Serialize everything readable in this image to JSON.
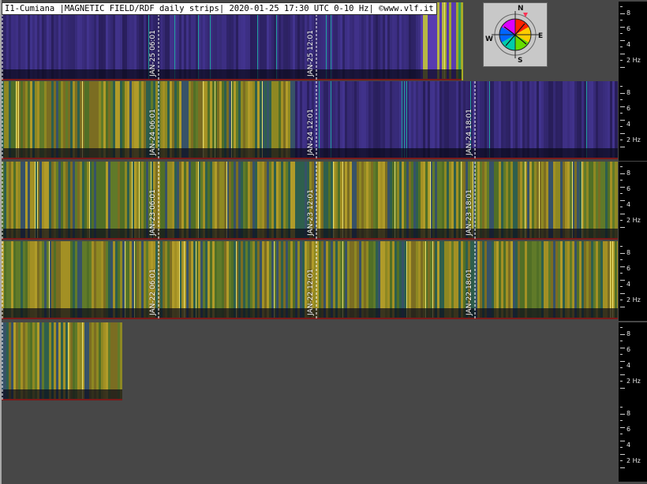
{
  "header": {
    "title": "I1-Cumiana |MAGNETIC FIELD/RDF daily strips| 2020-01-25 17:30 UTC 0-10 Hz| ©www.vlf.it"
  },
  "compass": {
    "north": "N",
    "south": "S",
    "east": "E",
    "west": "W"
  },
  "chart_data": {
    "type": "heatmap",
    "description_axis": "frequency",
    "ylim": [
      0,
      10
    ],
    "frequency_scale": {
      "ticks": [
        "8",
        "6",
        "4",
        "2 Hz"
      ]
    },
    "strips": [
      {
        "labels": [
          "JAN-25 06:01",
          "JAN-25 12:01"
        ],
        "fill_fraction": 0.746
      },
      {
        "labels": [
          "JAN-24 06:01",
          "JAN-24 12:01",
          "JAN-24 18:01"
        ],
        "fill_fraction": 1.0
      },
      {
        "labels": [
          "JAN-23 06:01",
          "JAN-23 12:01",
          "JAN-23 18:01"
        ],
        "fill_fraction": 1.0
      },
      {
        "labels": [
          "JAN-22 06:01",
          "JAN-22 12:01",
          "JAN-22 18:01"
        ],
        "fill_fraction": 1.0
      },
      {
        "labels": [],
        "fill_fraction": 0.196
      }
    ]
  },
  "colors": {
    "background": "#474747",
    "quiet_band": "#3a2f8c",
    "active_band": "#b5a81e",
    "marker_line": "#ffffff"
  }
}
